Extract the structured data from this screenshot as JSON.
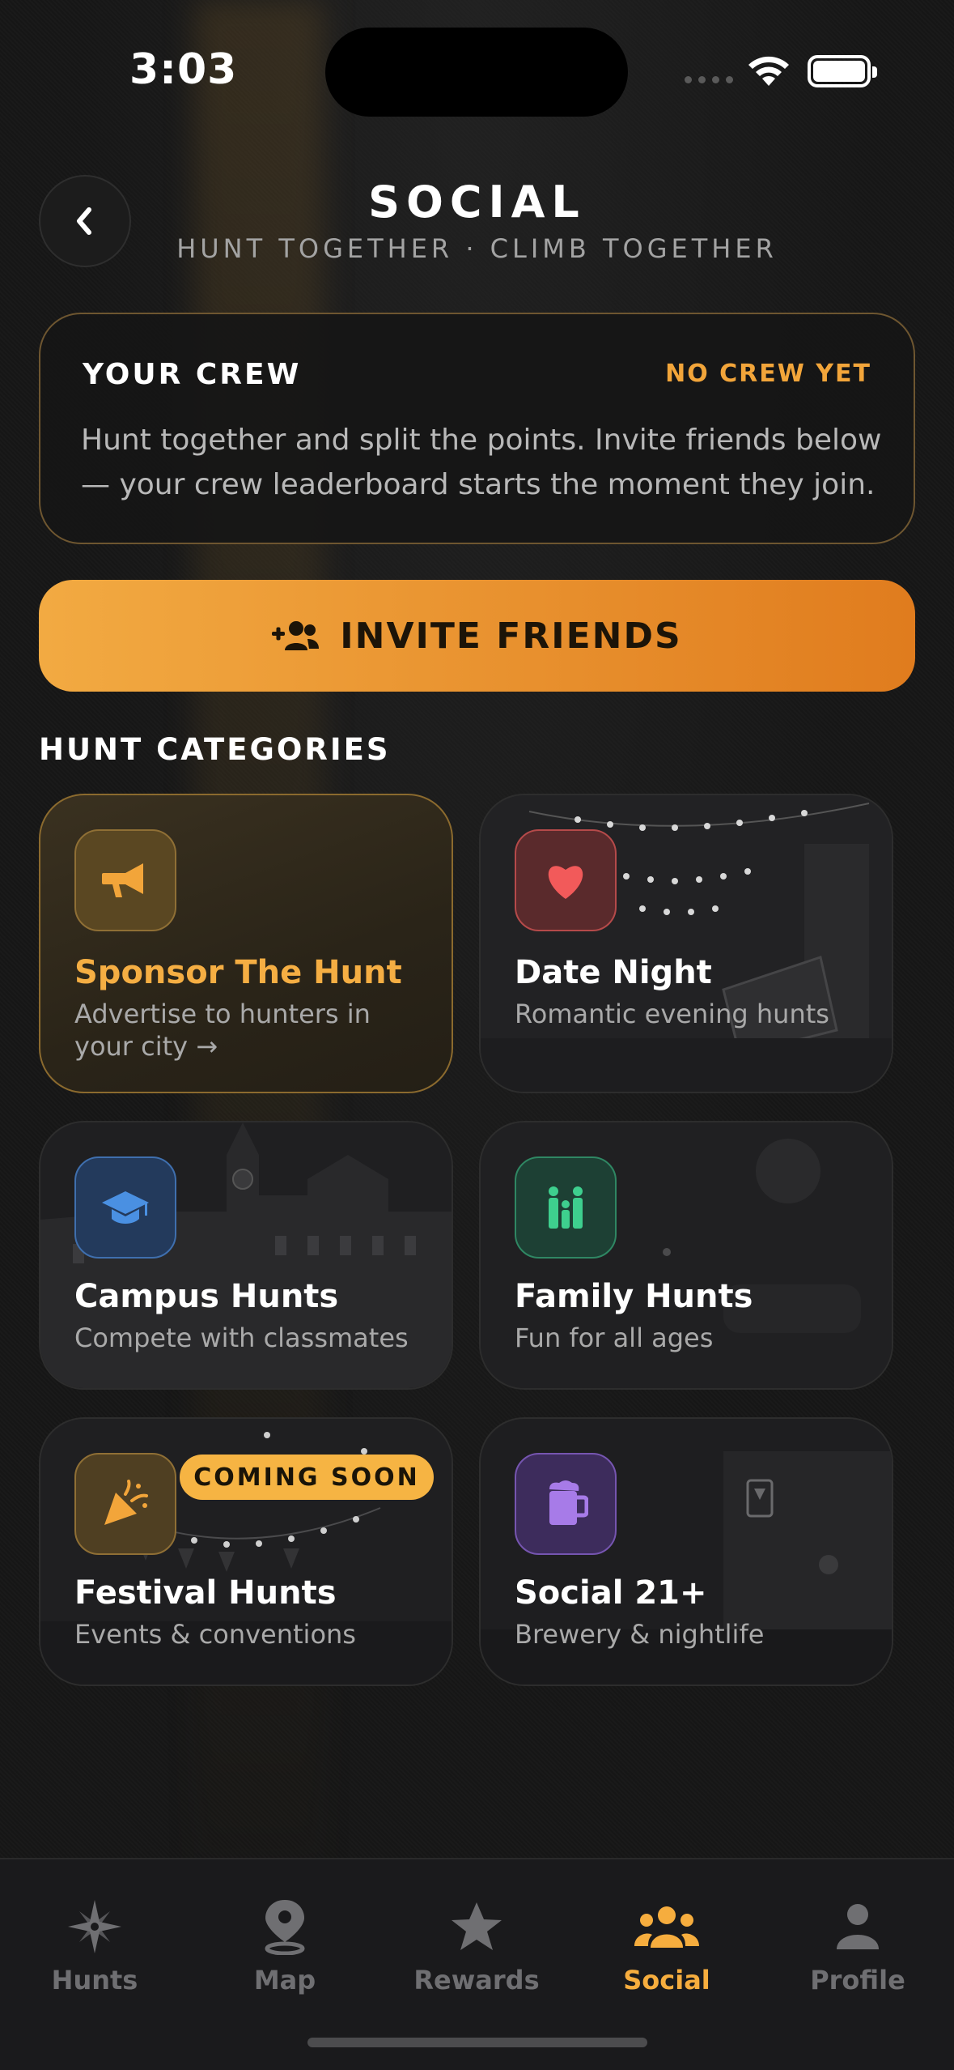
{
  "status_bar": {
    "time": "3:03"
  },
  "header": {
    "title": "SOCIAL",
    "subtitle": "HUNT TOGETHER · CLIMB TOGETHER",
    "back_icon": "chevron-left-icon"
  },
  "crew": {
    "title": "YOUR CREW",
    "status": "NO CREW YET",
    "description": "Hunt together and split the points. Invite friends below — your crew leaderboard starts the moment they join."
  },
  "invite": {
    "label": "INVITE FRIENDS",
    "icon": "user-plus-icon"
  },
  "categories_section": {
    "title": "HUNT CATEGORIES"
  },
  "categories": [
    {
      "title": "Sponsor The Hunt",
      "description": "Advertise to hunters in your city →",
      "icon": "megaphone-icon",
      "accent": "#f2a53a"
    },
    {
      "title": "Date Night",
      "description": "Romantic evening hunts",
      "icon": "heart-icon",
      "accent": "#f25a5a"
    },
    {
      "title": "Campus Hunts",
      "description": "Compete with classmates",
      "icon": "graduation-cap-icon",
      "accent": "#4a90e2"
    },
    {
      "title": "Family Hunts",
      "description": "Fun for all ages",
      "icon": "family-icon",
      "accent": "#3ecf8e"
    },
    {
      "title": "Festival Hunts",
      "description": "Events & conventions",
      "icon": "party-popper-icon",
      "accent": "#f2a53a",
      "badge": "COMING SOON"
    },
    {
      "title": "Social 21+",
      "description": "Brewery & nightlife",
      "icon": "beer-mug-icon",
      "accent": "#a77be8"
    }
  ],
  "tabs": [
    {
      "label": "Hunts",
      "icon": "compass-star-icon",
      "active": false
    },
    {
      "label": "Map",
      "icon": "map-pin-icon",
      "active": false
    },
    {
      "label": "Rewards",
      "icon": "star-icon",
      "active": false
    },
    {
      "label": "Social",
      "icon": "users-icon",
      "active": true
    },
    {
      "label": "Profile",
      "icon": "person-icon",
      "active": false
    }
  ],
  "colors": {
    "accent": "#f2a53a",
    "background": "#161616"
  }
}
